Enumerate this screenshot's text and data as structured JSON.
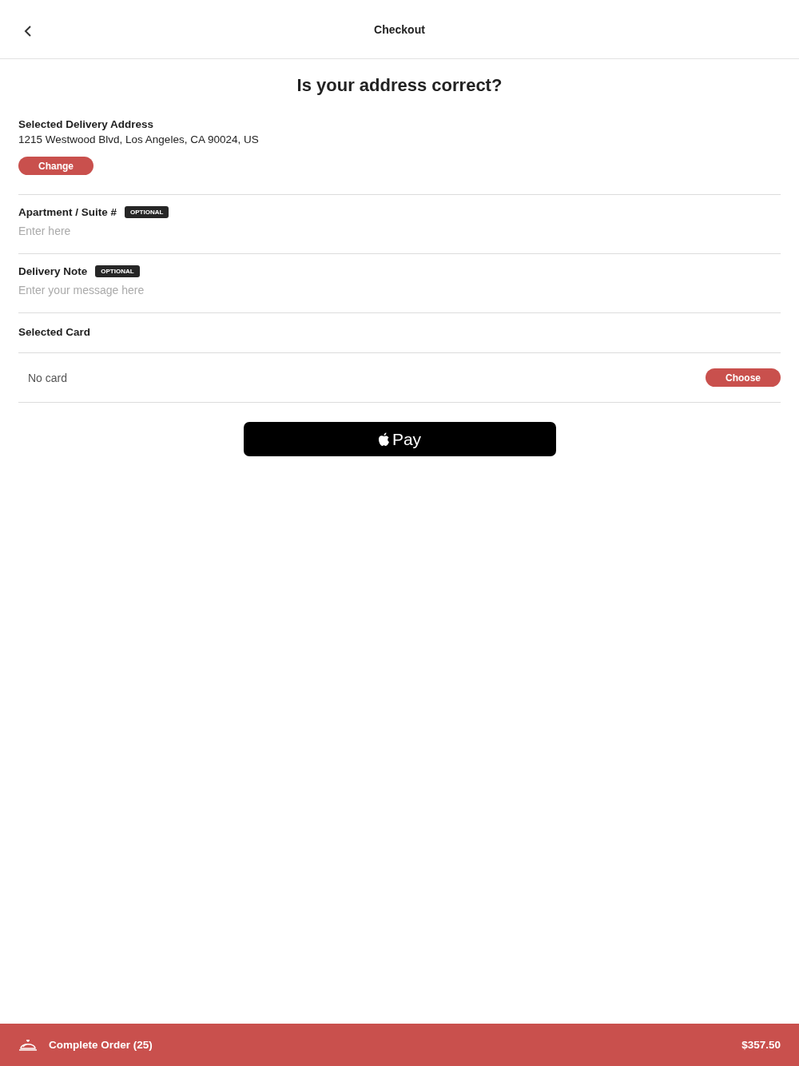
{
  "header": {
    "title": "Checkout"
  },
  "heading": "Is your address correct?",
  "address": {
    "label": "Selected Delivery Address",
    "value": "1215 Westwood Blvd, Los Angeles, CA 90024, US",
    "button": "Change"
  },
  "fields": [
    {
      "label": "Apartment / Suite #",
      "badge": "OPTIONAL",
      "placeholder": "Enter here"
    },
    {
      "label": "Delivery Note",
      "badge": "OPTIONAL",
      "placeholder": "Enter your message here"
    }
  ],
  "card": {
    "label": "Selected Card",
    "value": "No card",
    "button": "Choose"
  },
  "pay_button": {
    "label": "Pay"
  },
  "footer": {
    "label": "Complete Order (25)",
    "total": "$357.50"
  }
}
